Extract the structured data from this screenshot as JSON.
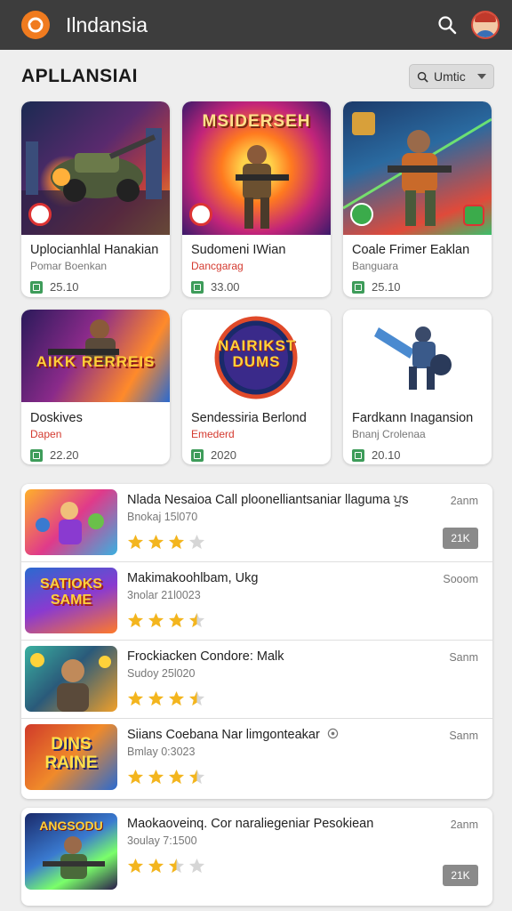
{
  "topbar": {
    "title": "Ilndansia",
    "logo_icon": "orange-swirl-logo",
    "search_icon": "search-icon",
    "avatar_icon": "user-avatar-icon",
    "bar_color": "#3d3d3d",
    "logo_color": "#f07b1f"
  },
  "section": {
    "title": "APLLANSIAI",
    "filter_label": "Umtic",
    "filter_icon": "search-icon",
    "filter_chevron": "chevron-down-icon"
  },
  "featured": [
    {
      "name": "Uplocianhlal Hanakian",
      "sub": "Pomar Boenkan",
      "stat": "25.10",
      "sub_color": "gray"
    },
    {
      "name": "Sudomeni IWian",
      "sub": "Dancgarag",
      "stat": "33.00",
      "sub_color": "red",
      "poster_text": "MSIDERSEH"
    },
    {
      "name": "Coale Frimer Eaklan",
      "sub": "Banguara",
      "stat": "25.10",
      "sub_color": "gray"
    },
    {
      "name": "Doskives",
      "sub": "Dapen",
      "stat": "22.20",
      "sub_color": "red",
      "poster_text": "AIKK RERREIS"
    },
    {
      "name": "Sendessiria Berlond",
      "sub": "Emederd",
      "stat": "2020",
      "sub_color": "red",
      "poster_text": "NAIRIKST DUMS"
    },
    {
      "name": "Fardkann Inagansion",
      "sub": "Bnanj Crolenaa",
      "stat": "20.10",
      "sub_color": "gray"
    }
  ],
  "list_group_1": [
    {
      "title": "Nlada Nesaioa Call ploonelliantsaniar llaguma ਪੂs",
      "sub": "Bnokaj 15l070",
      "time": "2anm",
      "rating": 3,
      "pill": "21K"
    },
    {
      "title": "Makimakoohlbam, Ukg",
      "sub": "3nolar 21l0023",
      "time": "Sooom",
      "rating": 3.5
    },
    {
      "title": "Frockiacken Condore: Malk",
      "sub": "Sudoy 25l020",
      "time": "Sanm",
      "rating": 3.5
    },
    {
      "title": "Siians Coebana Nar limgonteakar",
      "sub": "Bmlay 0:3023",
      "time": "Sanm",
      "rating": 3.5,
      "title_icon": "info-circle-icon"
    }
  ],
  "list_group_2": [
    {
      "title": "Maokaoveinq. Cor naraliegeniar Pesokiean",
      "sub": "3oulay 7:1500",
      "time": "2anm",
      "rating": 2.5,
      "pill": "21K"
    }
  ],
  "thumb_texts": [
    "",
    "SATIOKS SAME",
    "",
    "DINS RAINE",
    "ANGSODU"
  ],
  "colors": {
    "star": "#f3b51e",
    "star_empty": "#d6d6d6",
    "download_green": "#3e9c5a",
    "accent_red": "#d43a2f"
  }
}
